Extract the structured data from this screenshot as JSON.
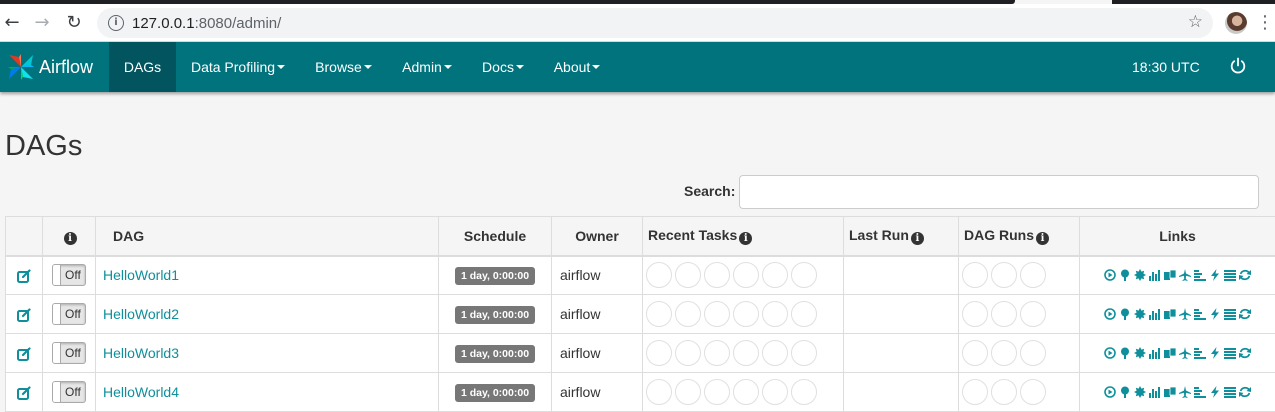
{
  "browser": {
    "url_host": "127.0.0.1",
    "url_rest": ":8080/admin/",
    "icons": [
      "back-arrow-icon",
      "forward-arrow-icon",
      "reload-icon",
      "info-icon",
      "star-icon",
      "profile-avatar",
      "more-menu-icon"
    ]
  },
  "navbar": {
    "brand": "Airflow",
    "items": [
      {
        "label": "DAGs",
        "active": true,
        "dropdown": false
      },
      {
        "label": "Data Profiling",
        "active": false,
        "dropdown": true
      },
      {
        "label": "Browse",
        "active": false,
        "dropdown": true
      },
      {
        "label": "Admin",
        "active": false,
        "dropdown": true
      },
      {
        "label": "Docs",
        "active": false,
        "dropdown": true
      },
      {
        "label": "About",
        "active": false,
        "dropdown": true
      }
    ],
    "clock": "18:30 UTC",
    "colors": {
      "bar": "#00737d",
      "active": "#02545e"
    }
  },
  "page": {
    "title": "DAGs",
    "search_label": "Search:",
    "search_value": ""
  },
  "table": {
    "headers": {
      "dag": "DAG",
      "schedule": "Schedule",
      "owner": "Owner",
      "recent_tasks": "Recent Tasks",
      "last_run": "Last Run",
      "dag_runs": "DAG Runs",
      "links": "Links"
    },
    "rows": [
      {
        "name": "HelloWorld1",
        "toggle": "Off",
        "schedule": "1 day, 0:00:00",
        "owner": "airflow",
        "last_run": ""
      },
      {
        "name": "HelloWorld2",
        "toggle": "Off",
        "schedule": "1 day, 0:00:00",
        "owner": "airflow",
        "last_run": ""
      },
      {
        "name": "HelloWorld3",
        "toggle": "Off",
        "schedule": "1 day, 0:00:00",
        "owner": "airflow",
        "last_run": ""
      },
      {
        "name": "HelloWorld4",
        "toggle": "Off",
        "schedule": "1 day, 0:00:00",
        "owner": "airflow",
        "last_run": ""
      }
    ],
    "recent_task_circles": 6,
    "dag_run_circles": 3,
    "link_icons": [
      "trigger-dag-icon",
      "tree-view-icon",
      "graph-view-icon",
      "task-duration-icon",
      "task-tries-icon",
      "landing-times-icon",
      "gantt-icon",
      "code-view-icon",
      "logs-icon",
      "refresh-icon"
    ],
    "accent": "#0e8f9b"
  }
}
